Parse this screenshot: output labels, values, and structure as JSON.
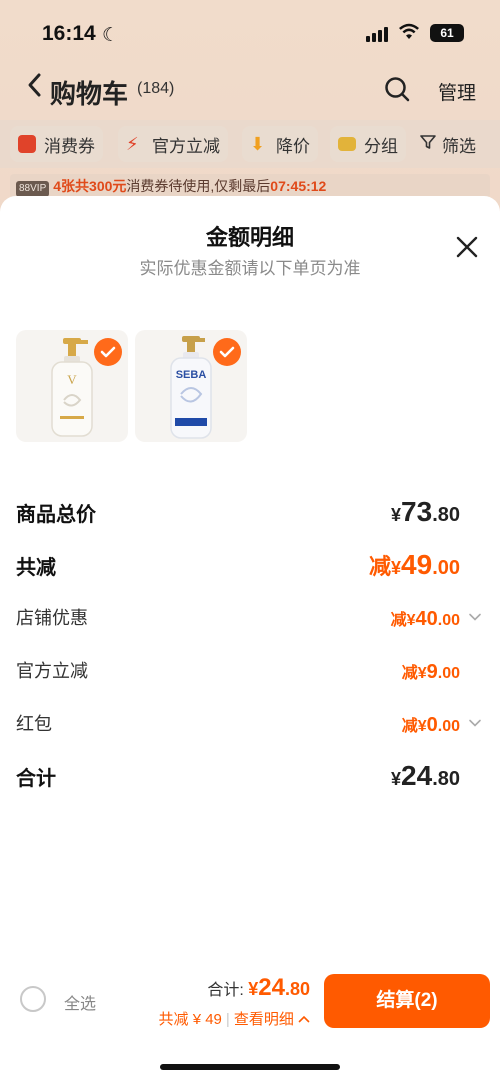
{
  "status_bar": {
    "time": "16:14",
    "battery": "61"
  },
  "nav": {
    "title": "购物车",
    "count": "(184)",
    "manage": "管理"
  },
  "chips": [
    {
      "label": "消费券",
      "color": "#e0432a"
    },
    {
      "label": "官方立减",
      "color": "#e0432a"
    },
    {
      "label": "降价",
      "color": "#f0a020"
    },
    {
      "label": "分组",
      "color": "#e2b33a"
    },
    {
      "label": "筛选",
      "color": "#333333"
    }
  ],
  "banner": {
    "vip": "88VIP",
    "highlight": "4张共300元",
    "text": "消费券待使用,仅剩最后",
    "countdown": "07:45:12"
  },
  "sheet": {
    "title": "金额明细",
    "subtitle": "实际优惠金额请以下单页为准",
    "products": [
      {
        "name": "white-shampoo-bottle",
        "selected": true
      },
      {
        "name": "blue-shampoo-bottle",
        "selected": true
      }
    ],
    "rows": {
      "subtotal": {
        "label": "商品总价",
        "yen": "¥",
        "int": "73",
        "dec": ".80"
      },
      "total_discount": {
        "label": "共减",
        "prefix": "减",
        "yen": "¥",
        "int": "49",
        "dec": ".00"
      },
      "store_discount": {
        "label": "店铺优惠",
        "prefix": "减",
        "yen": "¥",
        "int": "40",
        "dec": ".00"
      },
      "official_discount": {
        "label": "官方立减",
        "prefix": "减",
        "yen": "¥",
        "int": "9",
        "dec": ".00"
      },
      "red_packet": {
        "label": "红包",
        "prefix": "减",
        "yen": "¥",
        "int": "0",
        "dec": ".00"
      },
      "grand_total": {
        "label": "合计",
        "yen": "¥",
        "int": "24",
        "dec": ".80"
      }
    }
  },
  "footer": {
    "select_all": "全选",
    "total_label": "合计:",
    "total_yen": "¥",
    "total_int": "24",
    "total_dec": ".80",
    "savings_text": "共减 ¥ 49",
    "details_link": "查看明细",
    "checkout": "结算(2)"
  },
  "colors": {
    "accent": "#ff5a00",
    "check": "#ff6a1a"
  }
}
